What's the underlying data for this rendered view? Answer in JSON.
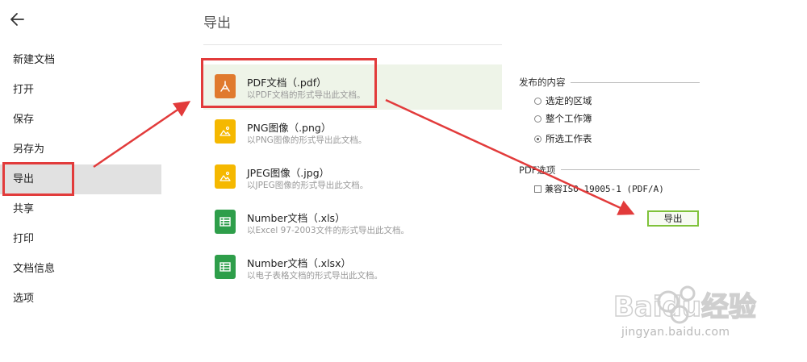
{
  "sidebar": {
    "items": [
      {
        "label": "新建文档",
        "active": false
      },
      {
        "label": "打开",
        "active": false
      },
      {
        "label": "保存",
        "active": false
      },
      {
        "label": "另存为",
        "active": false
      },
      {
        "label": "导出",
        "active": true
      },
      {
        "label": "共享",
        "active": false
      },
      {
        "label": "打印",
        "active": false
      },
      {
        "label": "文档信息",
        "active": false
      },
      {
        "label": "选项",
        "active": false
      }
    ]
  },
  "main": {
    "title": "导出",
    "formats": [
      {
        "name": "PDF文档（.pdf）",
        "desc": "以PDF文档的形式导出此文档。",
        "icon": "pdf-icon",
        "color": "#e07a2e",
        "selected": true
      },
      {
        "name": "PNG图像（.png）",
        "desc": "以PNG图像的形式导出此文档。",
        "icon": "image-icon",
        "color": "#f5b800",
        "selected": false
      },
      {
        "name": "JPEG图像（.jpg）",
        "desc": "以JPEG图像的形式导出此文档。",
        "icon": "image-icon",
        "color": "#f5b800",
        "selected": false
      },
      {
        "name": "Number文档（.xls）",
        "desc": "以Excel 97-2003文件的形式导出此文档。",
        "icon": "spreadsheet-icon",
        "color": "#2e9e4a",
        "selected": false
      },
      {
        "name": "Number文档（.xlsx）",
        "desc": "以电子表格文档的形式导出此文档。",
        "icon": "spreadsheet-icon",
        "color": "#2e9e4a",
        "selected": false
      }
    ]
  },
  "options": {
    "publish_label": "发布的内容",
    "radios": [
      {
        "label": "选定的区域",
        "checked": false
      },
      {
        "label": "整个工作簿",
        "checked": false
      },
      {
        "label": "所选工作表",
        "checked": true
      }
    ],
    "pdf_label": "PDF选项",
    "compat_label": "兼容ISO 19005-1 (PDF/A)",
    "compat_checked": false,
    "export_button": "导出"
  },
  "watermark": {
    "brand": "Baidu经验",
    "url": "jingyan.baidu.com"
  },
  "colors": {
    "annotation": "#e23b3b",
    "accent_green": "#7fc23a",
    "selected_bg": "#eef4e8"
  }
}
